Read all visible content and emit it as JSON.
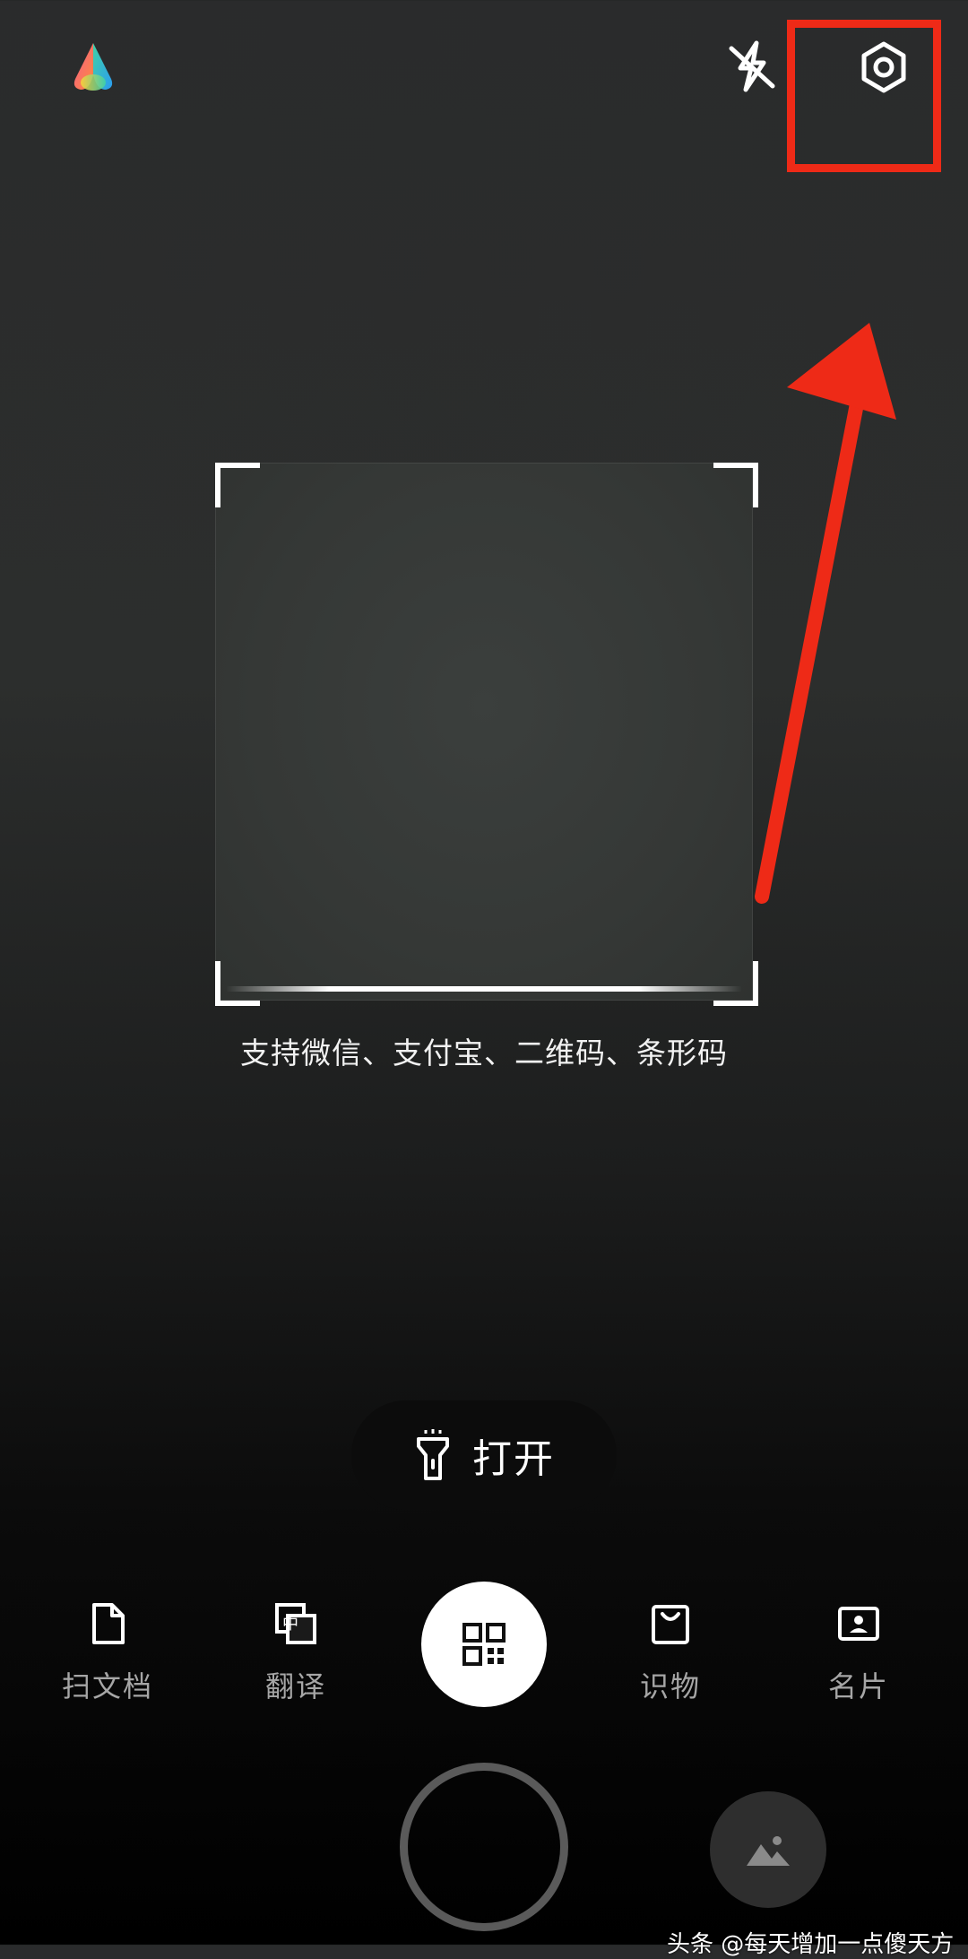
{
  "top_bar": {
    "logo_icon": "app-logo-icon",
    "flash_icon": "flash-off-icon",
    "settings_icon": "settings-gear-icon"
  },
  "annotation": {
    "highlight_color": "#ee2a17",
    "arrow_color": "#ee2a17"
  },
  "scanner": {
    "hint": "支持微信、支付宝、二维码、条形码"
  },
  "torch": {
    "icon": "flashlight-icon",
    "label": "打开"
  },
  "modes": [
    {
      "label": "扫文档",
      "icon": "document-icon"
    },
    {
      "label": "翻译",
      "icon": "translate-icon"
    },
    {
      "label": "",
      "icon": "qr-code-icon",
      "active": true
    },
    {
      "label": "识物",
      "icon": "shopping-bag-icon"
    },
    {
      "label": "名片",
      "icon": "business-card-icon"
    }
  ],
  "bottom": {
    "shutter": "shutter-button",
    "gallery_icon": "gallery-image-icon"
  },
  "watermark": "头条 @每天增加一点傻天方"
}
